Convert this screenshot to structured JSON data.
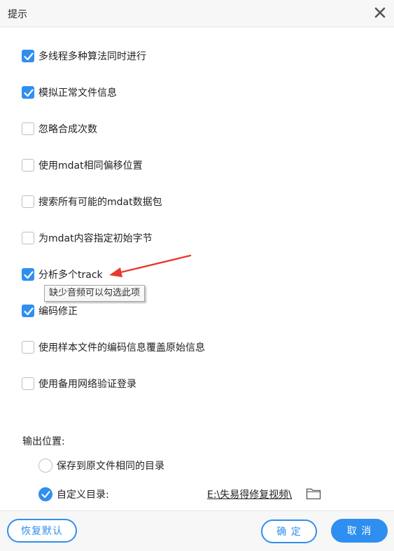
{
  "window": {
    "title": "提示"
  },
  "options": [
    {
      "label": "多线程多种算法同时进行",
      "checked": true
    },
    {
      "label": "模拟正常文件信息",
      "checked": true
    },
    {
      "label": "忽略合成次数",
      "checked": false
    },
    {
      "label": "使用mdat相同偏移位置",
      "checked": false
    },
    {
      "label": "搜索所有可能的mdat数据包",
      "checked": false
    },
    {
      "label": "为mdat内容指定初始字节",
      "checked": false
    },
    {
      "label": "分析多个track",
      "checked": true
    },
    {
      "label": "编码修正",
      "checked": true
    },
    {
      "label": "使用样本文件的编码信息覆盖原始信息",
      "checked": false
    },
    {
      "label": "使用备用网络验证登录",
      "checked": false
    }
  ],
  "tooltip": {
    "text": "缺少音频可以勾选此项"
  },
  "output": {
    "section_label": "输出位置:",
    "same_dir_label": "保存到原文件相同的目录",
    "same_dir_selected": false,
    "custom_dir_label": "自定义目录:",
    "custom_dir_selected": true,
    "custom_path": "E:\\失易得修复视频\\"
  },
  "footer": {
    "restore_label": "恢复默认",
    "ok_label": "确 定",
    "cancel_label": "取 消"
  },
  "colors": {
    "accent": "#2f8ff0",
    "annotation": "#e8392f"
  },
  "icons": {
    "close": "close-icon",
    "folder": "folder-icon",
    "check": "check-icon"
  }
}
